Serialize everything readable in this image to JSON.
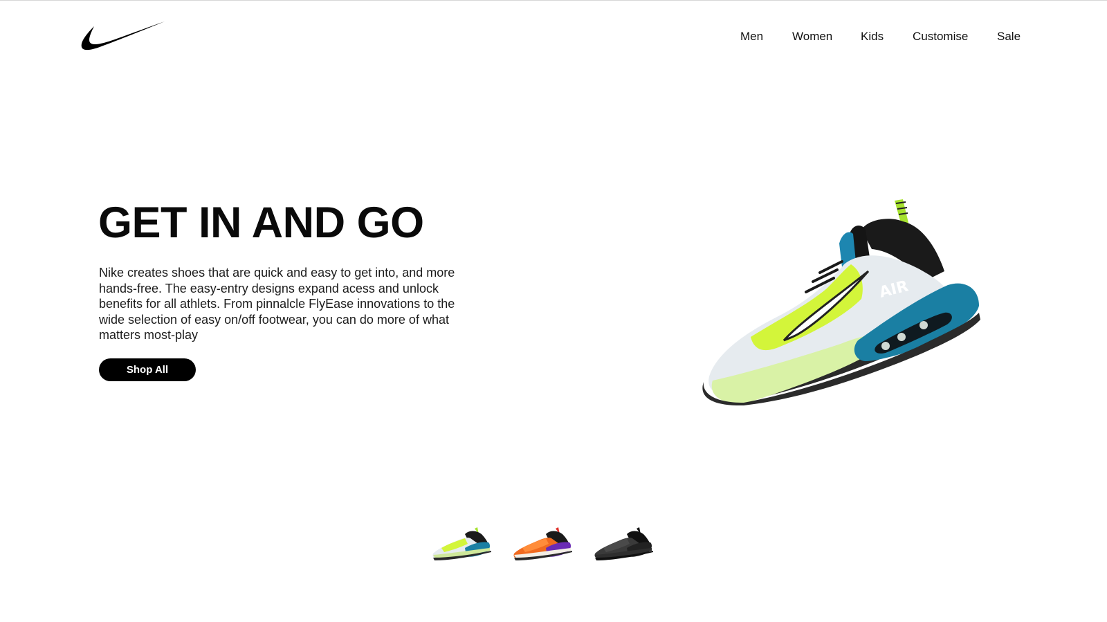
{
  "brand": {
    "logo_icon": "swoosh-icon",
    "logo_color": "#000000"
  },
  "nav": {
    "items": [
      {
        "label": "Men"
      },
      {
        "label": "Women"
      },
      {
        "label": "Kids"
      },
      {
        "label": "Customise"
      },
      {
        "label": "Sale"
      }
    ]
  },
  "hero": {
    "title": "GET IN AND GO",
    "description": "Nike creates shoes that are quick and easy to get into, and more hands-free. The easy-entry designs expand acess and unlock benefits for all athlets. From pinnalcle FlyEase innovations to the wide selection of easy on/off footwear, you can do more of what matters most-play",
    "button_label": "Shop All",
    "image_icon": "sneaker-volt-blue-icon"
  },
  "thumbnails": [
    {
      "icon": "sneaker-volt-blue-icon",
      "accent": "#c8f23c"
    },
    {
      "icon": "sneaker-orange-purple-icon",
      "accent": "#f06a1f"
    },
    {
      "icon": "sneaker-black-icon",
      "accent": "#2b2b2b"
    }
  ],
  "colors": {
    "background": "#ffffff",
    "text": "#111111",
    "button_bg": "#000000",
    "button_text": "#ffffff"
  }
}
